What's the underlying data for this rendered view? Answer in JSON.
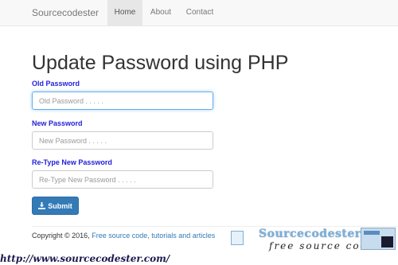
{
  "navbar": {
    "brand": "Sourcecodester",
    "items": [
      {
        "label": "Home",
        "active": true
      },
      {
        "label": "About",
        "active": false
      },
      {
        "label": "Contact",
        "active": false
      }
    ]
  },
  "page": {
    "title": "Update Password using PHP"
  },
  "form": {
    "old_password": {
      "label": "Old Password",
      "placeholder": "Old Password . . . . .",
      "value": "",
      "focused": true
    },
    "new_password": {
      "label": "New Password",
      "placeholder": "New Password . . . . .",
      "value": ""
    },
    "retype_password": {
      "label": "Re-Type New Password",
      "placeholder": "Re-Type New Password . . . . .",
      "value": ""
    },
    "submit_label": "Submit",
    "submit_icon": "download-icon"
  },
  "footer": {
    "copyright": "Copyright © 2016,",
    "link_text": "Free source code, tutorials and articles"
  },
  "watermark": {
    "logo_text": "Sourcecodester.com",
    "tagline": "free source code",
    "url": "http://www.sourcecodester.com/"
  },
  "colors": {
    "label": "#1f1fd8",
    "primary_button": "#337ab7",
    "link": "#337ab7",
    "focus_border": "#66afe9"
  }
}
